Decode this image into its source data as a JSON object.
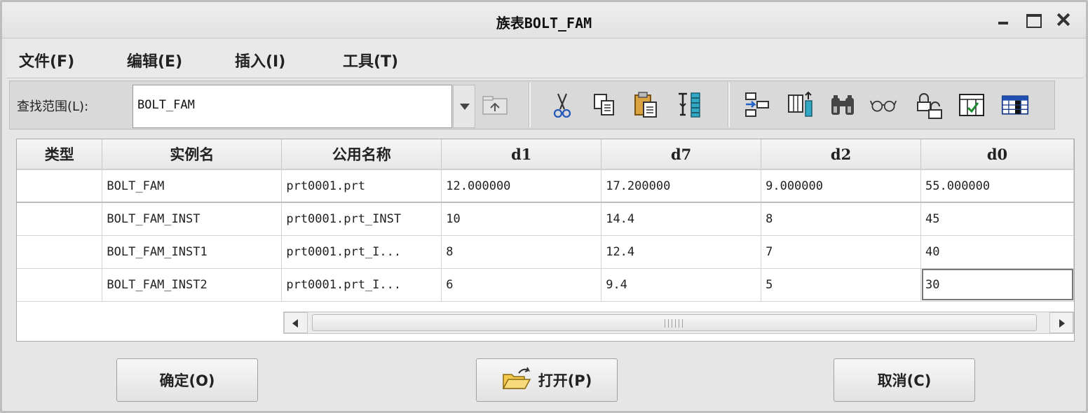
{
  "window": {
    "title": "族表BOLT_FAM",
    "controls": [
      "minimize-icon",
      "maximize-icon",
      "close-icon"
    ]
  },
  "menu": [
    "文件(F)",
    "编辑(E)",
    "插入(I)",
    "工具(T)"
  ],
  "toolbar": {
    "lookin_label": "查找范围(L):",
    "lookin_value": "BOLT_FAM",
    "icons": [
      "up-folder-icon",
      "cut-icon",
      "copy-icon",
      "paste-icon",
      "fill-table-icon",
      "insert-instance-icon",
      "add-column-icon",
      "find-icon",
      "preview-icon",
      "lock-icon",
      "verify-icon",
      "edit-table-icon"
    ]
  },
  "table": {
    "columns": [
      "类型",
      "实例名",
      "公用名称",
      "d1",
      "d7",
      "d2",
      "d0"
    ],
    "rows": [
      [
        "",
        "BOLT_FAM",
        "prt0001.prt",
        "12.000000",
        "17.200000",
        "9.000000",
        "55.000000"
      ],
      [
        "",
        "BOLT_FAM_INST",
        "prt0001.prt_INST",
        "10",
        "14.4",
        "8",
        "45"
      ],
      [
        "",
        "BOLT_FAM_INST1",
        "prt0001.prt_I...",
        "8",
        "12.4",
        "7",
        "40"
      ],
      [
        "",
        "BOLT_FAM_INST2",
        "prt0001.prt_I...",
        "6",
        "9.4",
        "5",
        "30"
      ]
    ]
  },
  "buttons": {
    "ok": "确定(O)",
    "open": "打开(P)",
    "cancel": "取消(C)"
  }
}
